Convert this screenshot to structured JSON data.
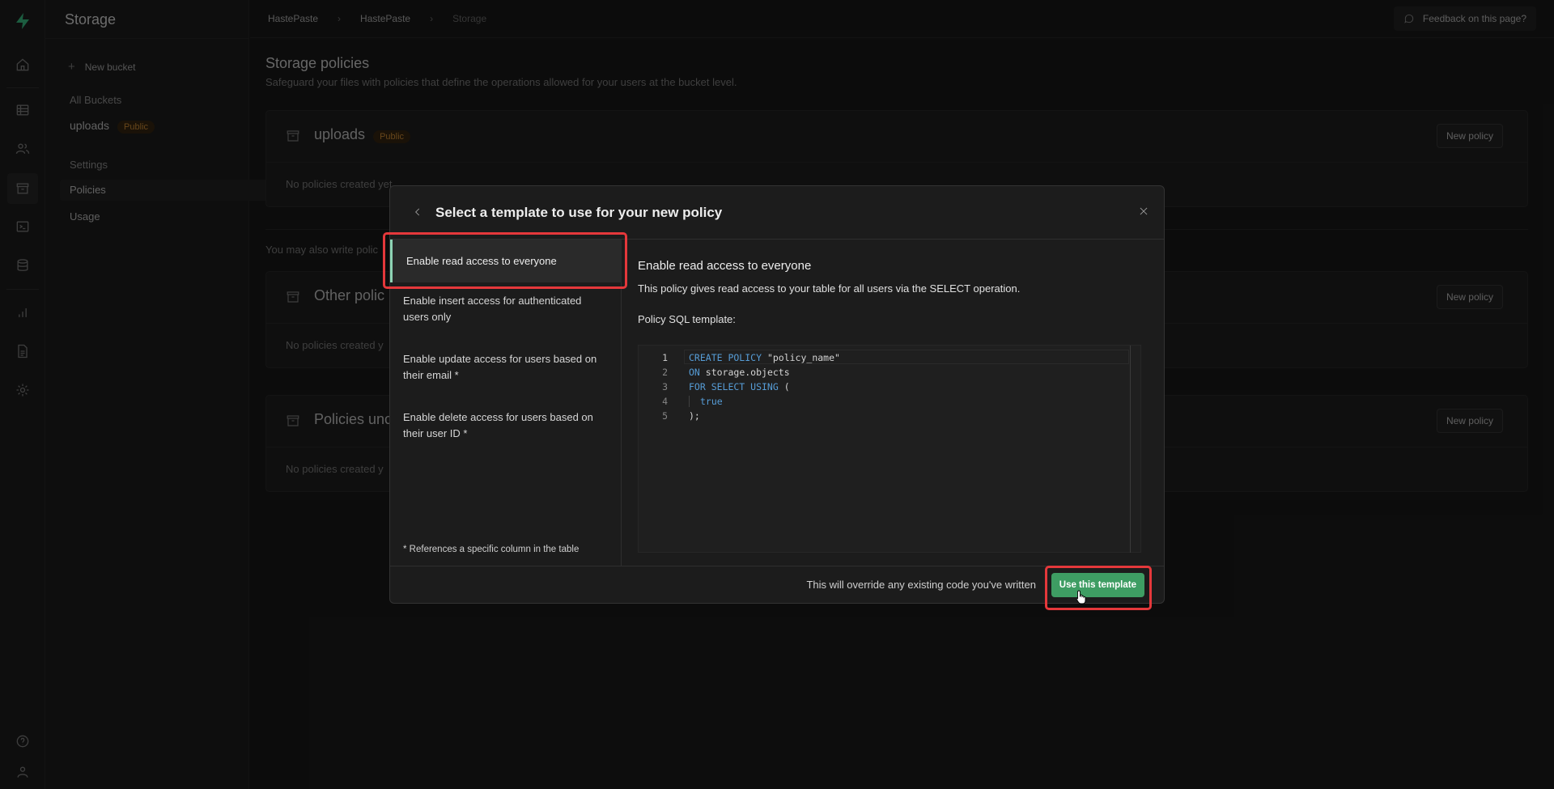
{
  "rail": {
    "icons": [
      "supabase-logo-icon",
      "home-icon",
      "table-editor-icon",
      "users-icon",
      "storage-icon",
      "sql-editor-icon",
      "database-icon",
      "reports-icon",
      "docs-icon",
      "settings-icon",
      "help-icon",
      "account-icon"
    ],
    "brand_color": "#3ecf8e"
  },
  "sidebar": {
    "title": "Storage",
    "new_bucket": "New bucket",
    "all_buckets_label": "All Buckets",
    "buckets": [
      {
        "name": "uploads",
        "badge": "Public"
      }
    ],
    "config_items": [
      "Settings",
      "Policies",
      "Usage"
    ],
    "selected": "Policies"
  },
  "header": {
    "breadcrumbs": [
      "HastePaste",
      "HastePaste",
      "Storage"
    ],
    "feedback": "Feedback on this page?"
  },
  "page": {
    "title": "Storage policies",
    "subtitle": "Safeguard your files with policies that define the operations allowed for your users at the bucket level.",
    "also_text": "You may also write polic",
    "cards": [
      {
        "name": "uploads",
        "badge": "Public",
        "empty": "No policies created yet",
        "button": "New policy"
      },
      {
        "name": "Other polic",
        "empty": "No policies created y",
        "button": "New policy"
      },
      {
        "name": "Policies unc",
        "empty": "No policies created y",
        "button": "New policy"
      }
    ]
  },
  "modal": {
    "title": "Select a template to use for your new policy",
    "templates": [
      "Enable read access to everyone",
      "Enable insert access for authenticated users only",
      "Enable update access for users based on their email *",
      "Enable delete access for users based on their user ID *"
    ],
    "selected_template": 0,
    "footnote": "* References a specific column in the table",
    "detail": {
      "title": "Enable read access to everyone",
      "description": "This policy gives read access to your table for all users via the SELECT operation.",
      "sql_label": "Policy SQL template:"
    },
    "code_lines": [
      {
        "n": "1",
        "kw1": "CREATE POLICY",
        "rest": " \"policy_name\""
      },
      {
        "n": "2",
        "kw1": "ON",
        "rest": " storage.objects"
      },
      {
        "n": "3",
        "kw1": "FOR SELECT USING",
        "rest": " ("
      },
      {
        "n": "4",
        "kw1": "",
        "rest": "true"
      },
      {
        "n": "5",
        "kw1": "",
        "rest": ");"
      }
    ],
    "footer_warning": "This will override any existing code you've written",
    "use_button": "Use this template",
    "accent_color": "#3e9d63",
    "highlight_color": "#e5383b"
  }
}
